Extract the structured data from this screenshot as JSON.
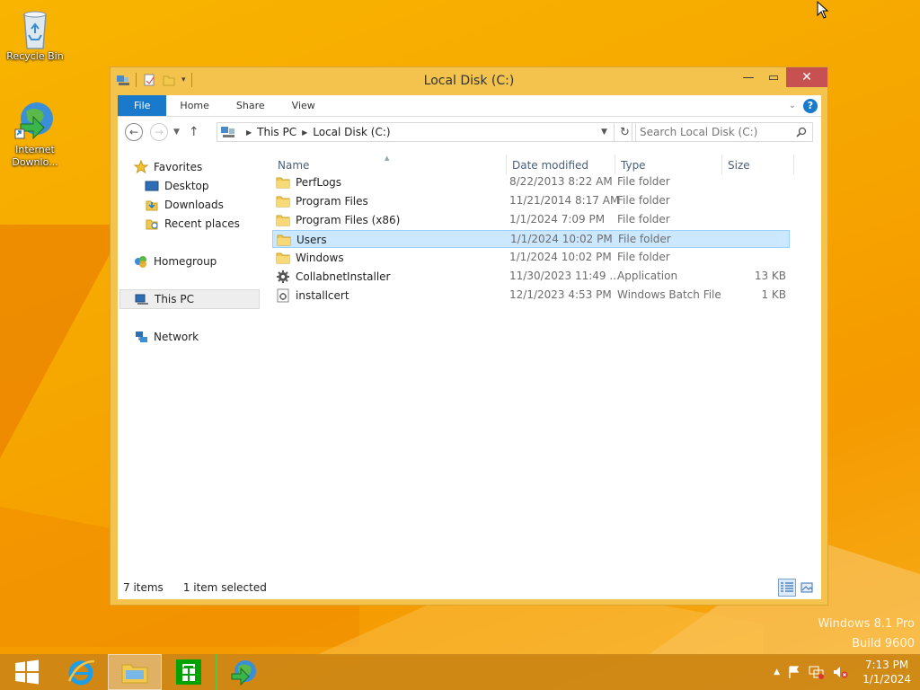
{
  "desktop": {
    "icons": [
      {
        "label": "Recycle Bin",
        "icon": "recycle-bin-icon"
      },
      {
        "label": "Internet Downlo...",
        "icon": "internet-download-manager-icon"
      }
    ],
    "watermark": {
      "line1": "Windows 8.1 Pro",
      "line2": "Build 9600"
    }
  },
  "window": {
    "title": "Local Disk (C:)",
    "ribbon_tabs": [
      "File",
      "Home",
      "Share",
      "View"
    ],
    "address": {
      "segments": [
        "This PC",
        "Local Disk (C:)"
      ]
    },
    "search_placeholder": "Search Local Disk (C:)",
    "nav": {
      "favorites": "Favorites",
      "desktop": "Desktop",
      "downloads": "Downloads",
      "recent": "Recent places",
      "homegroup": "Homegroup",
      "thispc": "This PC",
      "network": "Network"
    },
    "columns": {
      "name": "Name",
      "date": "Date modified",
      "type": "Type",
      "size": "Size"
    },
    "files": [
      {
        "name": "PerfLogs",
        "date": "8/22/2013 8:22 AM",
        "type": "File folder",
        "size": "",
        "icon": "folder-icon"
      },
      {
        "name": "Program Files",
        "date": "11/21/2014 8:17 AM",
        "type": "File folder",
        "size": "",
        "icon": "folder-icon"
      },
      {
        "name": "Program Files (x86)",
        "date": "1/1/2024 7:09 PM",
        "type": "File folder",
        "size": "",
        "icon": "folder-icon"
      },
      {
        "name": "Users",
        "date": "1/1/2024 10:02 PM",
        "type": "File folder",
        "size": "",
        "icon": "folder-icon",
        "selected": true
      },
      {
        "name": "Windows",
        "date": "1/1/2024 10:02 PM",
        "type": "File folder",
        "size": "",
        "icon": "folder-icon"
      },
      {
        "name": "CollabnetInstaller",
        "date": "11/30/2023 11:49 ...",
        "type": "Application",
        "size": "13 KB",
        "icon": "application-icon"
      },
      {
        "name": "installcert",
        "date": "12/1/2023 4:53 PM",
        "type": "Windows Batch File",
        "size": "1 KB",
        "icon": "batch-file-icon"
      }
    ],
    "status": {
      "count": "7 items",
      "selection": "1 item selected"
    }
  },
  "taskbar": {
    "clock_time": "7:13 PM",
    "clock_date": "1/1/2024"
  },
  "colors": {
    "accent": "#1979ca",
    "selection": "#cce8ff",
    "titlebar": "#f3c34d",
    "close": "#c75050"
  }
}
